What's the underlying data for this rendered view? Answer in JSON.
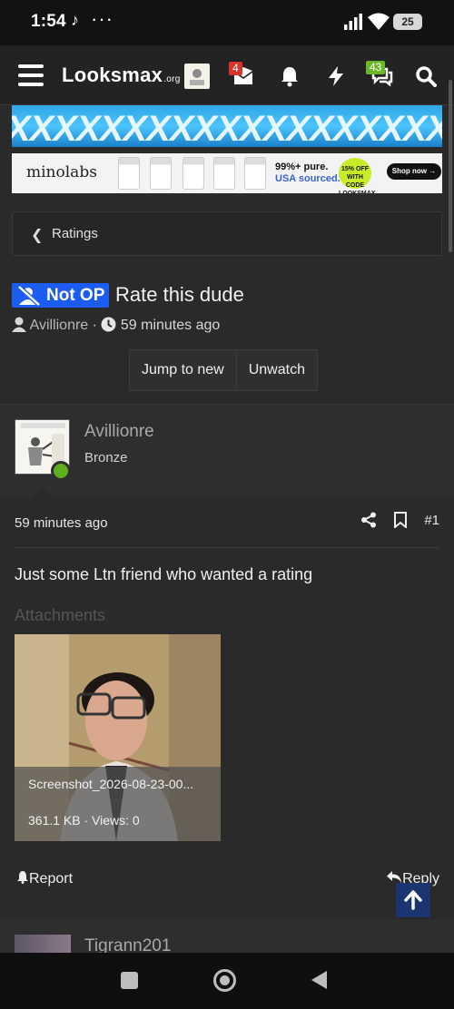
{
  "status_bar": {
    "time": "1:54",
    "tiktok_glyph": "♪",
    "more": "···",
    "battery": "25"
  },
  "header": {
    "logo_main": "Looksmax",
    "logo_suffix": ".org",
    "inbox_count": "4",
    "chat_count": "43"
  },
  "ads": {
    "banner_text": "XXXXXXXXXXXXXXXXXXXING",
    "minolabs": {
      "brand": "minolabs",
      "pure_line1": "99%+ pure.",
      "pure_line2": "USA sourced.",
      "discount": "15% OFF WITH CODE LOOKSMAX",
      "shop": "Shop now →"
    }
  },
  "breadcrumb": {
    "label": "Ratings"
  },
  "thread": {
    "prefix": "Not OP",
    "title": "Rate this dude",
    "author": "Avillionre",
    "separator": "·",
    "time": "59 minutes ago",
    "buttons": {
      "jump": "Jump to new",
      "unwatch": "Unwatch"
    }
  },
  "post": {
    "author": "Avillionre",
    "rank": "Bronze",
    "time": "59 minutes ago",
    "number": "#1",
    "body": "Just some Ltn friend who wanted a rating",
    "attachments_label": "Attachments",
    "attachment": {
      "filename": "Screenshot_2026-08-23-00...",
      "meta": "361.1 KB · Views: 0"
    },
    "report": "Report",
    "reply": "Reply"
  },
  "next_post": {
    "author": "Tigrann201"
  },
  "colors": {
    "accent": "#1c5cf0",
    "online": "#5fae1f",
    "badge_red": "#d9342b",
    "badge_green": "#6ab82a"
  }
}
